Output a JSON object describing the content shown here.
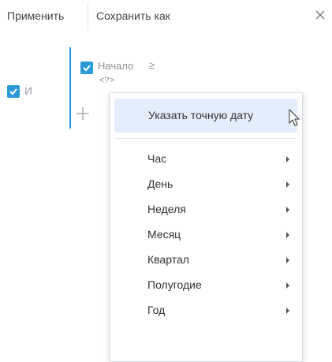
{
  "toolbar": {
    "apply_label": "Применить",
    "save_as_label": "Сохранить как",
    "close_icon": "close-icon"
  },
  "filter": {
    "group_operator": "И",
    "condition": {
      "column": "Начало",
      "operator": "≥",
      "value": "<?>"
    },
    "add_icon": "plus-icon"
  },
  "menu": {
    "highlighted": "Указать точную дату",
    "items": [
      {
        "label": "Час"
      },
      {
        "label": "День"
      },
      {
        "label": "Неделя"
      },
      {
        "label": "Месяц"
      },
      {
        "label": "Квартал"
      },
      {
        "label": "Полугодие"
      },
      {
        "label": "Год"
      }
    ]
  },
  "colors": {
    "accent": "#2b9ad6",
    "highlight": "#e4edfa"
  }
}
